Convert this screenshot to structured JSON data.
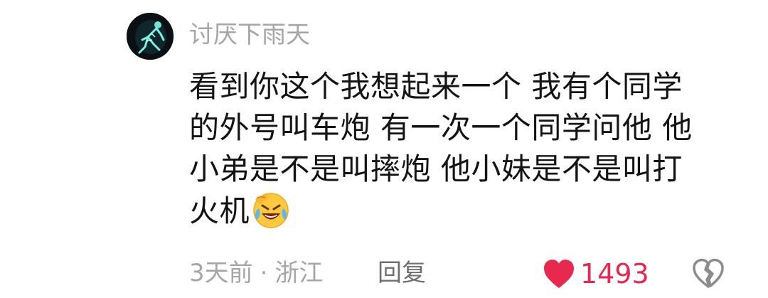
{
  "comment": {
    "username": "讨厌下雨天",
    "avatar_icon": "skeleton-avatar-icon",
    "text_lines": [
      "看到你这个我想起来一个 我有个同学",
      "的外号叫车炮 有一次一个同学问他 他",
      "小弟是不是叫摔炮 他小妹是不是叫打",
      "火机"
    ],
    "emoji_icon": "laughing-crying-emoji-icon",
    "time": "3天前",
    "separator": "·",
    "location": "浙江",
    "reply_label": "回复",
    "likes": "1493",
    "like_icon": "heart-icon",
    "dislike_icon": "broken-heart-icon"
  },
  "colors": {
    "like": "#e8284f",
    "meta": "#a6a6a6",
    "text": "#141414"
  }
}
